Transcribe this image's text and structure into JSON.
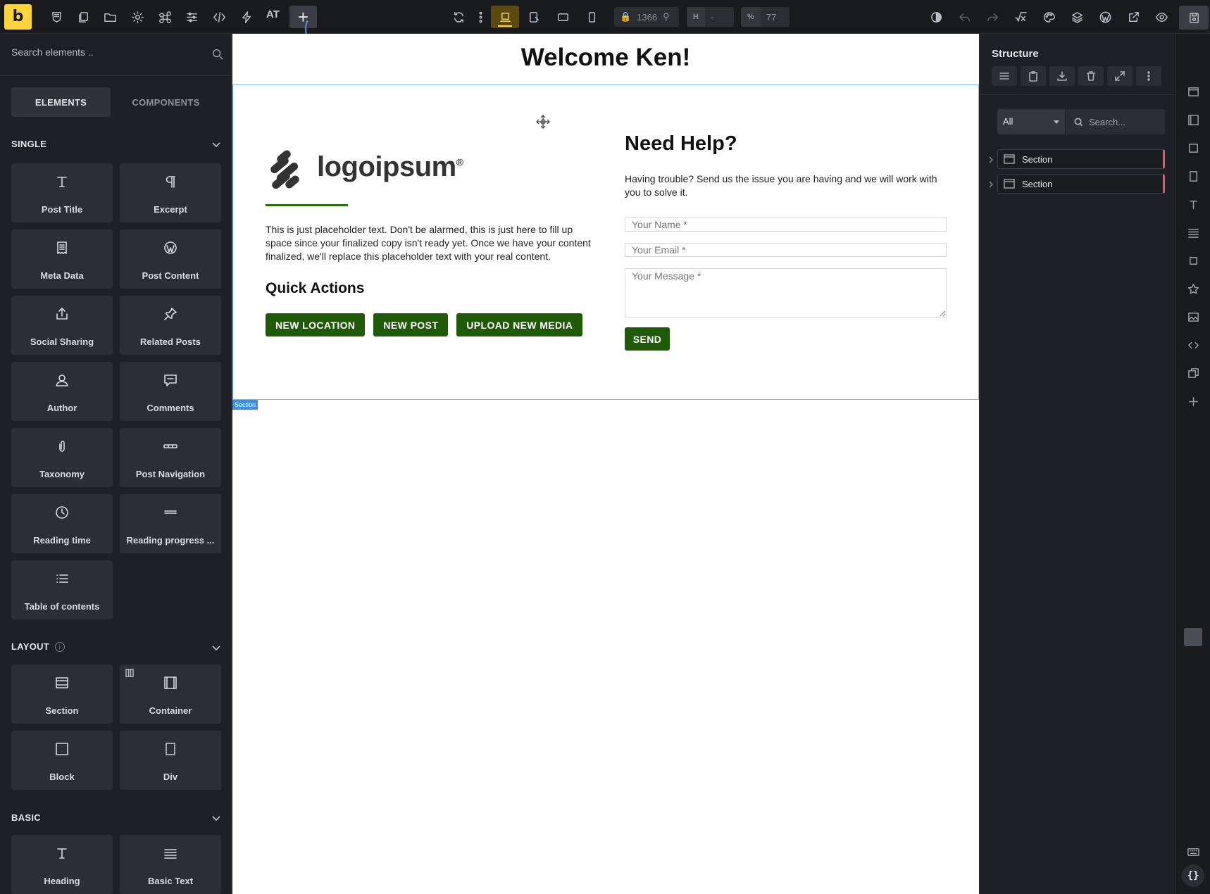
{
  "app": {
    "logo_letter": "b",
    "at_label": "AT",
    "add_label": "+"
  },
  "toolbar": {
    "width_value": "1366",
    "height_label": "H",
    "height_value": "-",
    "zoom_label": "%",
    "zoom_value": "77"
  },
  "left_panel": {
    "search_placeholder": "Search elements ..",
    "tabs": {
      "elements": "ELEMENTS",
      "components": "COMPONENTS"
    },
    "categories": {
      "single": "SINGLE",
      "layout": "LAYOUT",
      "layout_info": "i",
      "basic": "BASIC"
    },
    "single_items": [
      {
        "label": "Post Title",
        "icon": "text-t-icon"
      },
      {
        "label": "Excerpt",
        "icon": "paragraph-icon"
      },
      {
        "label": "Meta Data",
        "icon": "receipt-icon"
      },
      {
        "label": "Post Content",
        "icon": "wordpress-icon"
      },
      {
        "label": "Social Sharing",
        "icon": "share-icon"
      },
      {
        "label": "Related Posts",
        "icon": "pin-icon"
      },
      {
        "label": "Author",
        "icon": "user-icon"
      },
      {
        "label": "Comments",
        "icon": "comment-icon"
      },
      {
        "label": "Taxonomy",
        "icon": "paperclip-icon"
      },
      {
        "label": "Post Navigation",
        "icon": "dots-icon"
      },
      {
        "label": "Reading time",
        "icon": "clock-icon"
      },
      {
        "label": "Reading progress ...",
        "icon": "progress-icon"
      },
      {
        "label": "Table of contents",
        "icon": "list-icon"
      }
    ],
    "layout_items": [
      {
        "label": "Section",
        "icon": "section-icon"
      },
      {
        "label": "Container",
        "icon": "container-icon"
      },
      {
        "label": "Block",
        "icon": "block-icon"
      },
      {
        "label": "Div",
        "icon": "div-icon"
      }
    ],
    "basic_items": [
      {
        "label": "Heading",
        "icon": "text-t-icon"
      },
      {
        "label": "Basic Text",
        "icon": "text-lines-icon"
      }
    ]
  },
  "canvas": {
    "welcome": "Welcome Ken!",
    "brand_name": "logoipsum",
    "brand_mark": "®",
    "placeholder_text": "This is just placeholder text. Don't be alarmed, this is just here to fill up space since your finalized copy isn't ready yet. Once we have your content finalized, we'll replace this placeholder text with your real content.",
    "quick_actions_title": "Quick Actions",
    "quick_actions": [
      "NEW LOCATION",
      "NEW POST",
      "UPLOAD NEW MEDIA"
    ],
    "help_title": "Need Help?",
    "help_text": "Having trouble? Send us the issue you are having and we will work with you to solve it.",
    "form": {
      "name_placeholder": "Your Name *",
      "email_placeholder": "Your Email *",
      "message_placeholder": "Your Message *",
      "send_label": "SEND"
    },
    "section_badge": "Section"
  },
  "structure": {
    "title": "Structure",
    "filter_value": "All",
    "search_placeholder": "Search...",
    "rows": [
      "Section",
      "Section"
    ]
  },
  "colors": {
    "accent_yellow": "#ffd53e",
    "button_green": "#1f5b06",
    "rule_green": "#2f6b12",
    "selection_blue": "#7fb4e6",
    "structure_marker": "#e85470"
  }
}
